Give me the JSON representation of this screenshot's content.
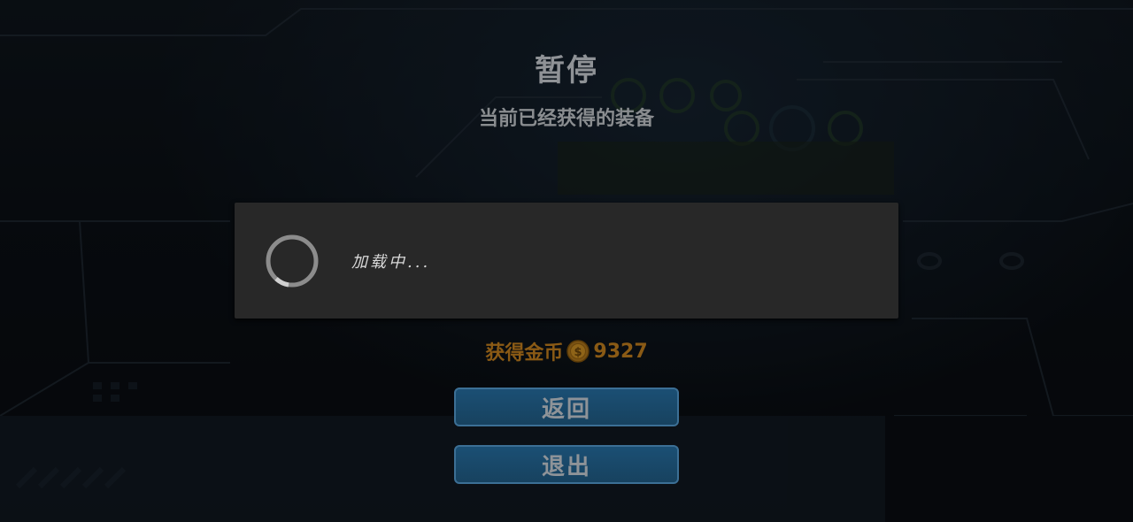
{
  "pause_menu": {
    "title": "暂停",
    "subtitle": "当前已经获得的装备"
  },
  "loading_dialog": {
    "text": "加载中..."
  },
  "coins": {
    "label": "获得金币",
    "value": "9327",
    "icon": "coin-icon"
  },
  "buttons": {
    "return_label": "返回",
    "exit_label": "退出"
  },
  "colors": {
    "title_text": "#8f9296",
    "dialog_background": "#282828",
    "coin_text": "#8a5a15",
    "button_fill": "#1b4f74",
    "button_border": "#3c6f95"
  }
}
